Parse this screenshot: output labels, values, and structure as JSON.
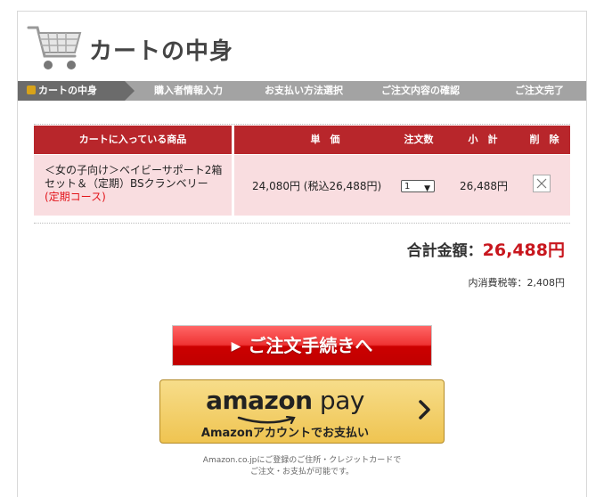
{
  "header": {
    "title": "カートの中身",
    "icon": "shopping-cart-icon"
  },
  "steps": [
    {
      "label": "カートの中身",
      "active": true
    },
    {
      "label": "購入者情報入力"
    },
    {
      "label": "お支払い方法選択"
    },
    {
      "label": "ご注文内容の確認"
    },
    {
      "label": "ご注文完了"
    }
  ],
  "table": {
    "headers": {
      "item": "カートに入っている商品",
      "price": "単　価",
      "qty": "注文数",
      "subtotal": "小　計",
      "delete": "削　除"
    },
    "rows": [
      {
        "name": "＜女の子向け＞ベイビーサポート2箱セット＆（定期）BSクランベリー",
        "course": "(定期コース)",
        "price": "24,080円 (税込26,488円)",
        "qty": "1",
        "subtotal": "26,488円"
      }
    ]
  },
  "summary": {
    "total_label": "合計金額：",
    "total_value": "26,488円",
    "tax_text": "内消費税等：2,408円"
  },
  "order_button": {
    "label": "ご注文手続きへ"
  },
  "amazon_pay": {
    "logo_amazon": "amazon",
    "logo_pay": " pay",
    "sub_label": "Amazonアカウントでお支払い",
    "note_line1": "Amazon.co.jpにご登録のご住所・クレジットカードで",
    "note_line2": "ご注文・お支払が可能です。"
  },
  "colors": {
    "header_red": "#b8262b",
    "row_pink": "#f9dde0",
    "total_red": "#c8161d",
    "step_gray": "#a3a3a3",
    "step_active": "#6b6b6b"
  }
}
